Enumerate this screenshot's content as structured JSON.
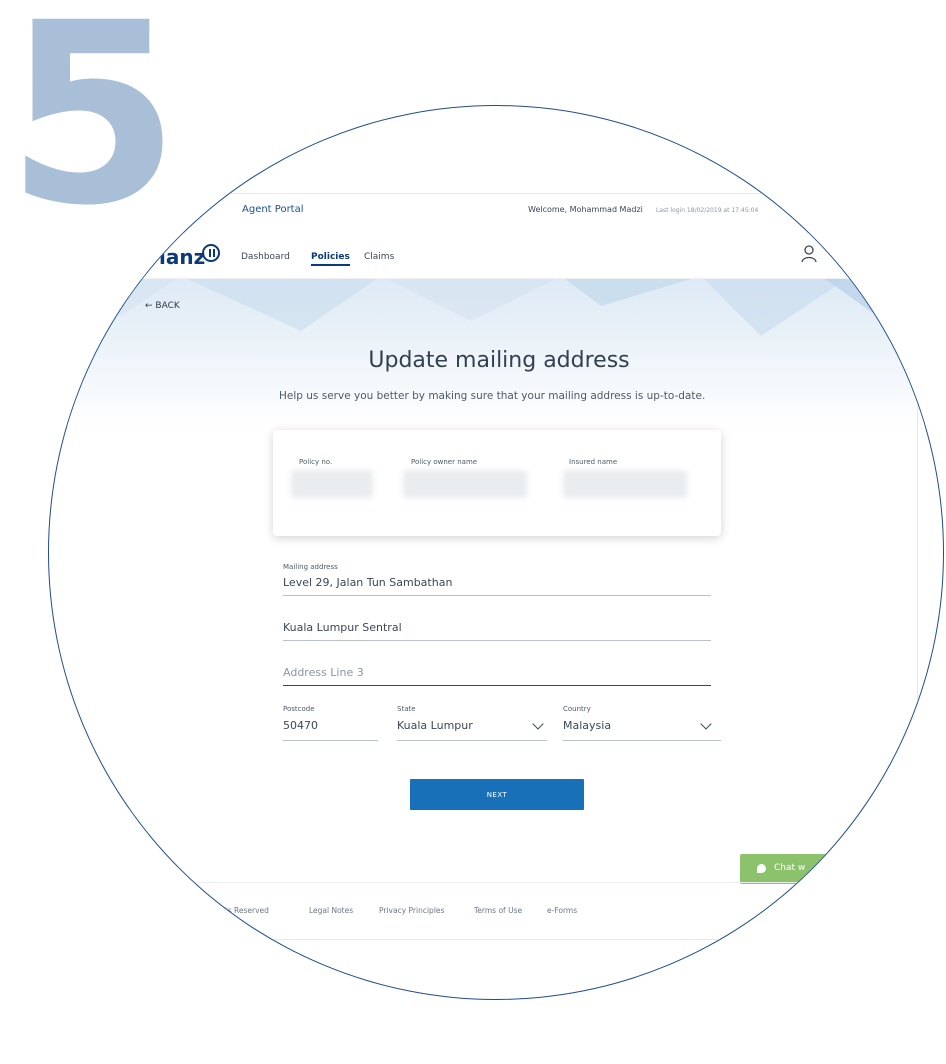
{
  "step_number": "5",
  "topbar": {
    "app_name": "Agent Portal",
    "welcome": "Welcome, Mohammad Madzi",
    "last_login": "Last login 18/02/2019 at 17:45:04"
  },
  "nav": {
    "logo": "ianz",
    "items": [
      "Dashboard",
      "Policies",
      "Claims"
    ],
    "active": "Policies"
  },
  "back_label": "← BACK",
  "page": {
    "title": "Update mailing address",
    "subtitle": "Help us serve you better by making sure that your mailing address is up-to-date."
  },
  "policy_card": {
    "policy_no_label": "Policy no.",
    "owner_label": "Policy owner name",
    "insured_label": "Insured name"
  },
  "form": {
    "mailing_address_label": "Mailing address",
    "address_line1": "Level 29, Jalan Tun Sambathan",
    "address_line2": "Kuala Lumpur Sentral",
    "address_line3_placeholder": "Address Line 3",
    "postcode_label": "Postcode",
    "postcode": "50470",
    "state_label": "State",
    "state": "Kuala Lumpur",
    "country_label": "Country",
    "country": "Malaysia"
  },
  "next_label": "NEXT",
  "chat_label": "Chat w",
  "footer": [
    "hts Reserved",
    "Legal Notes",
    "Privacy Principles",
    "Terms of Use",
    "e-Forms"
  ],
  "colors": {
    "brand": "#0a3a78",
    "button": "#1871b8",
    "chat": "#8cc26b",
    "step_number": "#a9bfd8",
    "circle_border": "#1f4d8c"
  }
}
